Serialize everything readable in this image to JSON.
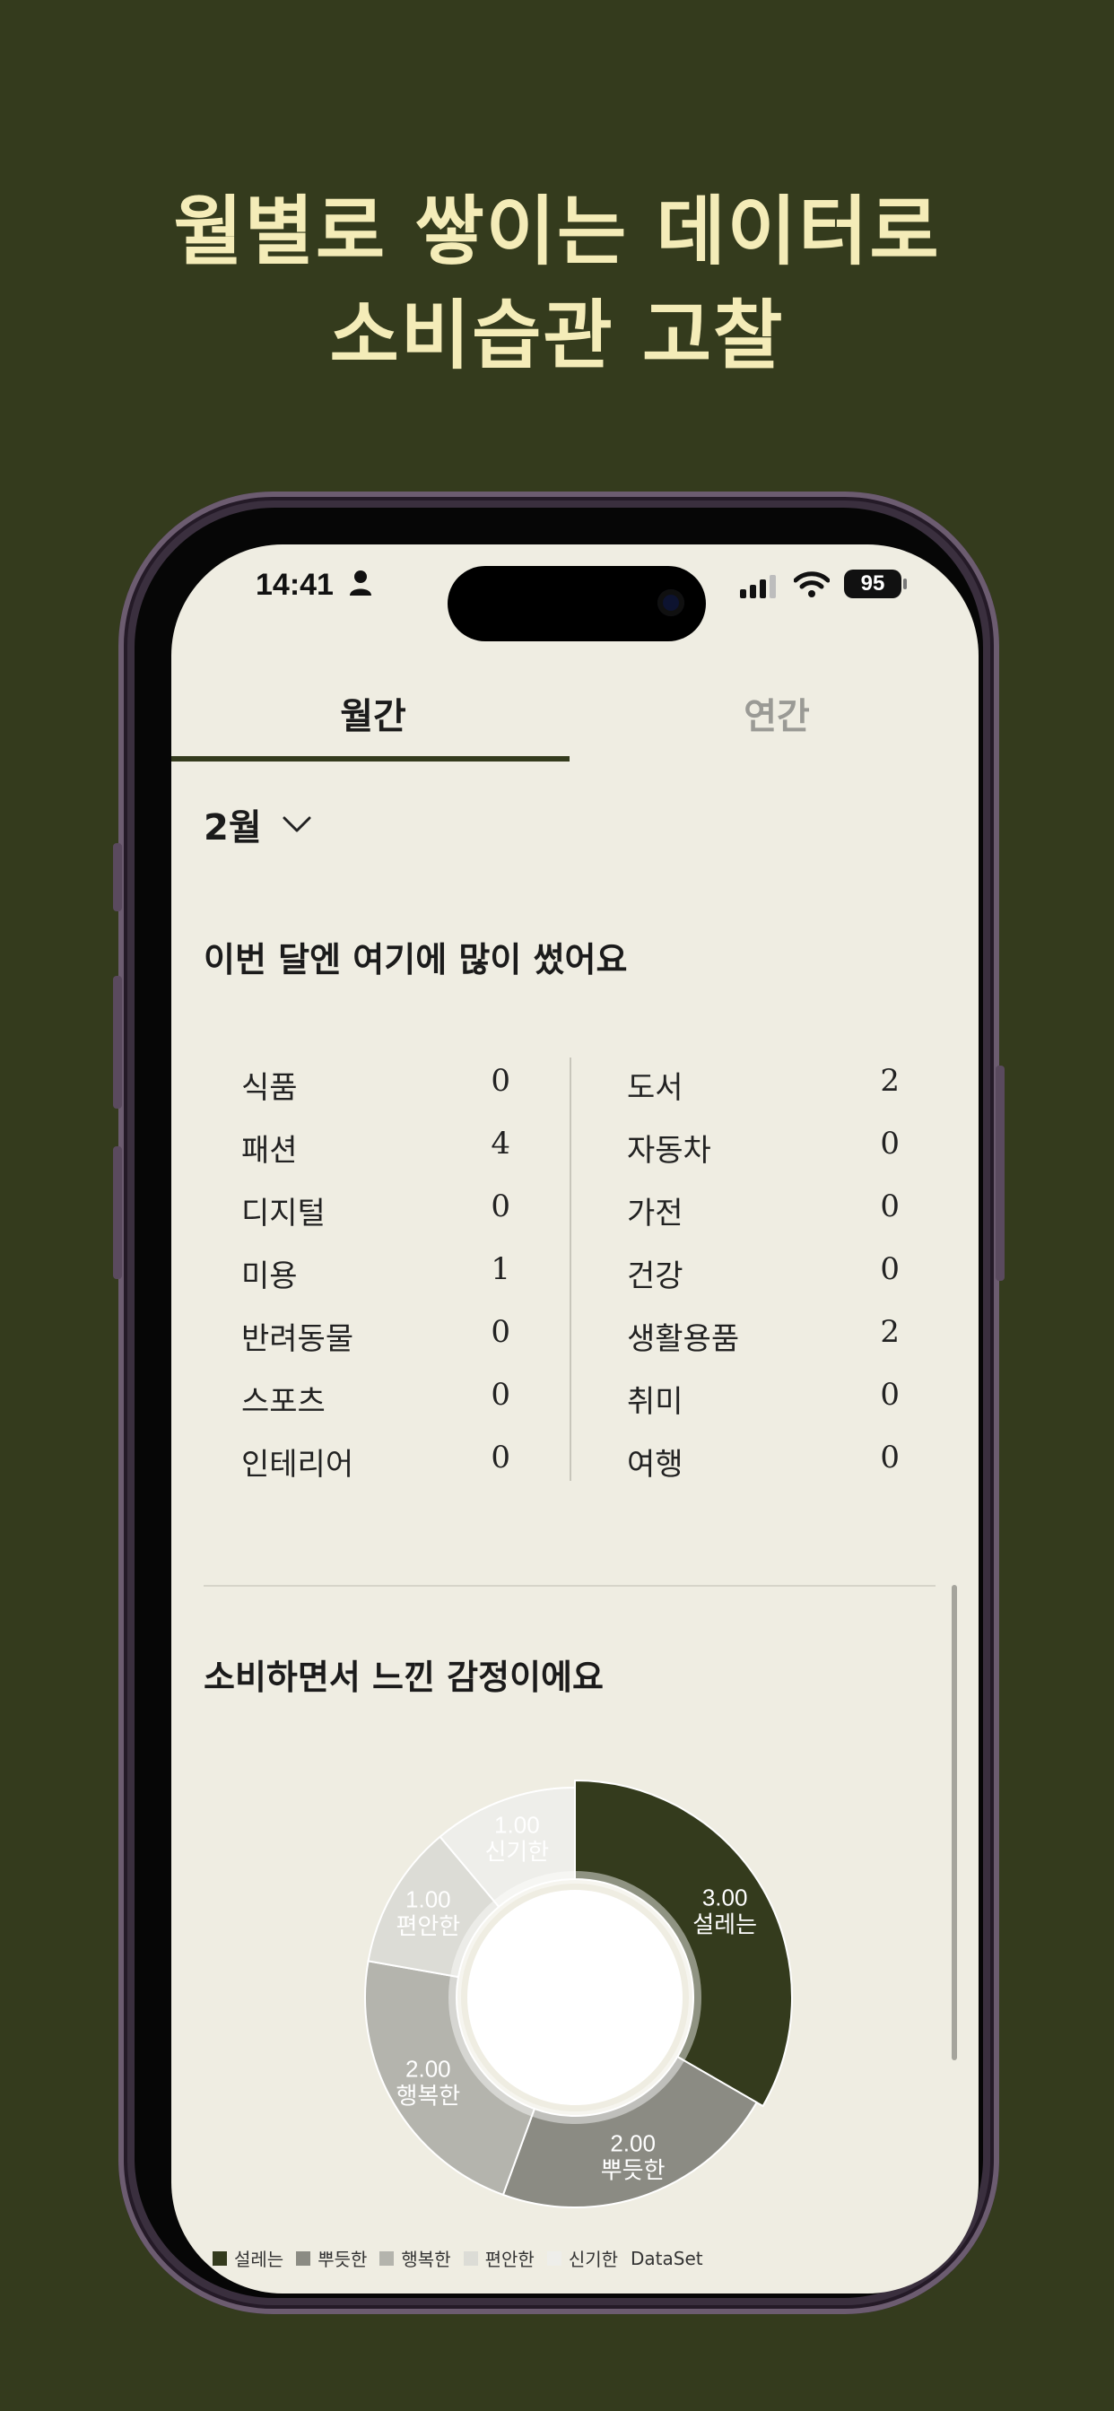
{
  "headline": {
    "line1": "월별로 쌓이는 데이터로",
    "line2": "소비습관 고찰"
  },
  "status_bar": {
    "time": "14:41",
    "battery": "95"
  },
  "tabs": [
    {
      "label": "월간",
      "selected": true
    },
    {
      "label": "연간",
      "selected": false
    }
  ],
  "month_select": {
    "value": "2월"
  },
  "categories_section": {
    "title": "이번 달엔 여기에 많이 썼어요",
    "left": [
      {
        "name": "식품",
        "count": "0"
      },
      {
        "name": "패션",
        "count": "4"
      },
      {
        "name": "디지털",
        "count": "0"
      },
      {
        "name": "미용",
        "count": "1"
      },
      {
        "name": "반려동물",
        "count": "0"
      },
      {
        "name": "스포츠",
        "count": "0"
      },
      {
        "name": "인테리어",
        "count": "0"
      }
    ],
    "right": [
      {
        "name": "도서",
        "count": "2"
      },
      {
        "name": "자동차",
        "count": "0"
      },
      {
        "name": "가전",
        "count": "0"
      },
      {
        "name": "건강",
        "count": "0"
      },
      {
        "name": "생활용품",
        "count": "2"
      },
      {
        "name": "취미",
        "count": "0"
      },
      {
        "name": "여행",
        "count": "0"
      }
    ]
  },
  "emotions_section": {
    "title": "소비하면서 느낀 감정이에요"
  },
  "chart_data": {
    "type": "pie",
    "donut": true,
    "series_name": "DataSet",
    "slices": [
      {
        "label": "설레는",
        "value": 3.0,
        "value_text": "3.00",
        "color": "#343b1d"
      },
      {
        "label": "뿌듯한",
        "value": 2.0,
        "value_text": "2.00",
        "color": "#8b8b83"
      },
      {
        "label": "행복한",
        "value": 2.0,
        "value_text": "2.00",
        "color": "#b4b4ad"
      },
      {
        "label": "편안한",
        "value": 1.0,
        "value_text": "1.00",
        "color": "#dcdcd6"
      },
      {
        "label": "신기한",
        "value": 1.0,
        "value_text": "1.00",
        "color": "#eeeeea"
      }
    ],
    "legend_position": "bottom-left"
  },
  "colors": {
    "background": "#343b1d",
    "headline": "#f4ecb8",
    "screen": "#efede2",
    "accent": "#343b1d"
  }
}
